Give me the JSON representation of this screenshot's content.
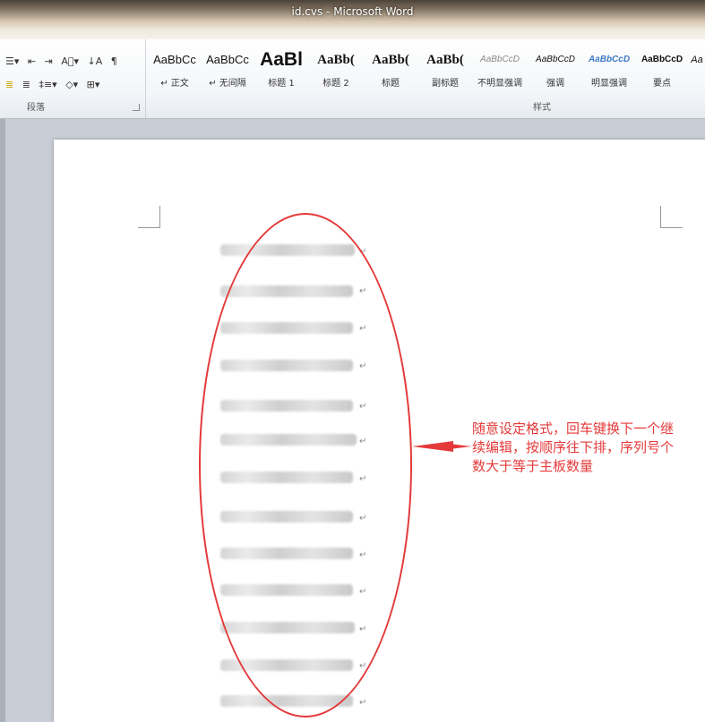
{
  "window": {
    "title": "id.cvs - Microsoft Word"
  },
  "ribbon": {
    "paragraph": {
      "label": "段落",
      "row1": [
        "☰▾",
        "⇤",
        "⇥",
        "A⃞▾",
        "↓A",
        "¶"
      ],
      "row2": [
        "≣",
        "≣",
        "‡≡▾",
        "◇▾",
        "⊞▾"
      ]
    },
    "styles": {
      "label": "样式",
      "items": [
        {
          "sample": "AaBbCc",
          "name": "↵ 正文"
        },
        {
          "sample": "AaBbCc",
          "name": "↵ 无间隔"
        },
        {
          "sample": "AaBl",
          "name": "标题 1"
        },
        {
          "sample": "AaBb(",
          "name": "标题 2"
        },
        {
          "sample": "AaBb(",
          "name": "标题"
        },
        {
          "sample": "AaBb(",
          "name": "副标题"
        },
        {
          "sample": "AaBbCcD",
          "name": "不明显强调"
        },
        {
          "sample": "AaBbCcD",
          "name": "强调"
        },
        {
          "sample": "AaBbCcD",
          "name": "明显强调"
        },
        {
          "sample": "AaBbCcD",
          "name": "要点"
        },
        {
          "sample": "Aa",
          "name": ""
        }
      ]
    }
  },
  "document": {
    "return_mark": "↵",
    "annotation": "随意设定格式，回车键换下一个继续编辑，按顺序往下排，序列号个数大于等于主板数量",
    "annotation_lines": [
      "随意设定格式，回车键换下一个继",
      "续编辑，按顺序往下排，序列号个",
      "数大于等于主板数量"
    ],
    "annotation_color": "#e43a3a"
  }
}
